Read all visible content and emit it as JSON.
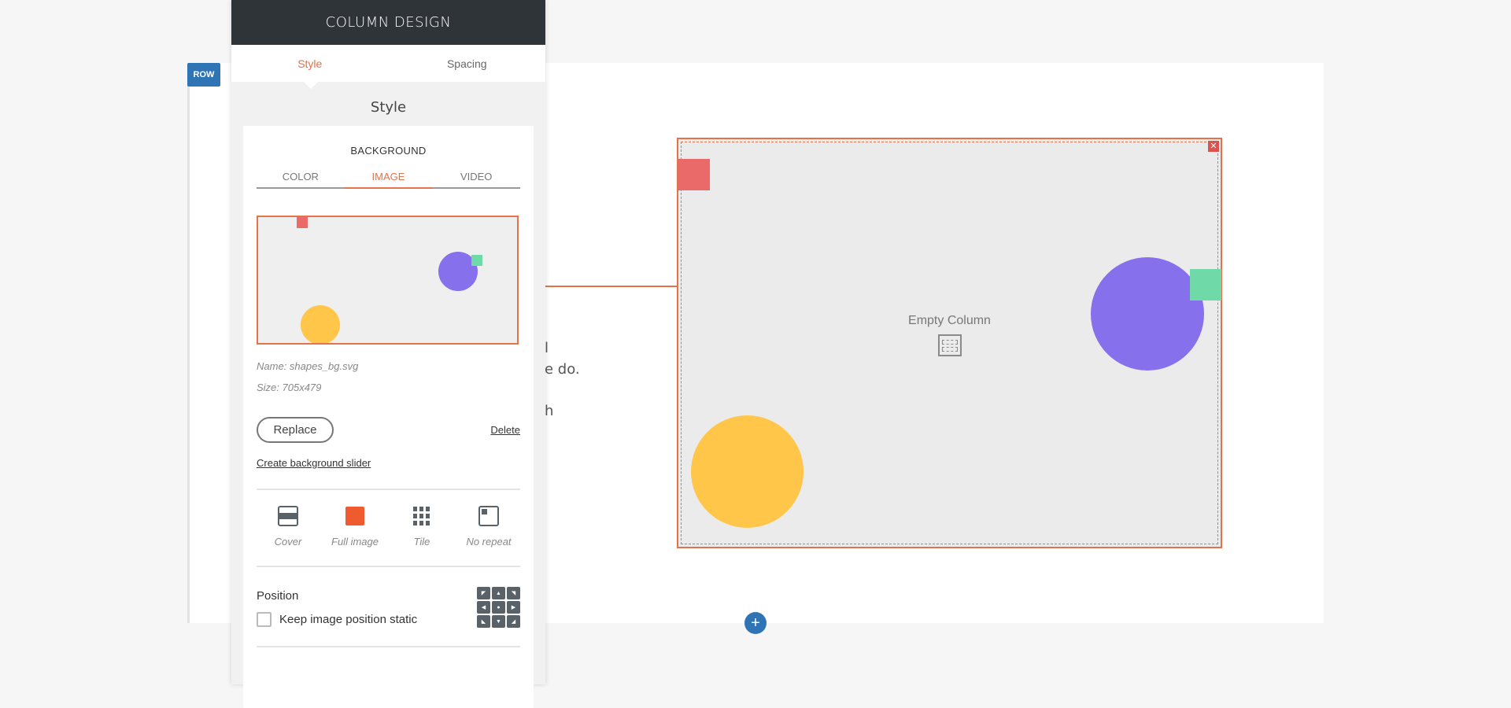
{
  "panel": {
    "title": "COLUMN DESIGN",
    "tabs": [
      {
        "label": "Style",
        "active": true
      },
      {
        "label": "Spacing",
        "active": false
      }
    ],
    "section_title": "Style"
  },
  "row_badge": "ROW",
  "background": {
    "heading": "BACKGROUND",
    "tabs": [
      {
        "label": "COLOR",
        "active": false
      },
      {
        "label": "IMAGE",
        "active": true
      },
      {
        "label": "VIDEO",
        "active": false
      }
    ],
    "image_name": "Name: shapes_bg.svg",
    "image_size": "Size: 705x479",
    "replace_label": "Replace",
    "delete_label": "Delete",
    "slider_link": "Create background slider",
    "modes": [
      {
        "label": "Cover",
        "icon": "cover-icon",
        "selected": false
      },
      {
        "label": "Full image",
        "icon": "full-image-icon",
        "selected": true
      },
      {
        "label": "Tile",
        "icon": "tile-icon",
        "selected": false
      },
      {
        "label": "No repeat",
        "icon": "no-repeat-icon",
        "selected": false
      }
    ],
    "position_label": "Position",
    "static_label": "Keep image position static",
    "static_checked": false,
    "position_grid_icons": [
      "arrow-up-left-icon",
      "arrow-up-icon",
      "arrow-up-right-icon",
      "arrow-left-icon",
      "center-dot-icon",
      "arrow-right-icon",
      "arrow-down-left-icon",
      "arrow-down-icon",
      "arrow-down-right-icon"
    ]
  },
  "column": {
    "empty_label": "Empty Column",
    "close_icon": "close-icon"
  },
  "background_text": [
    "l",
    "e do.",
    "h"
  ],
  "colors": {
    "accent": "#e2734a",
    "header_bg": "#2f3438",
    "row_badge": "#2f74b5",
    "shape_red": "#e96a68",
    "shape_green": "#6fd9a8",
    "shape_purple": "#8770ec",
    "shape_yellow": "#ffc64a"
  }
}
